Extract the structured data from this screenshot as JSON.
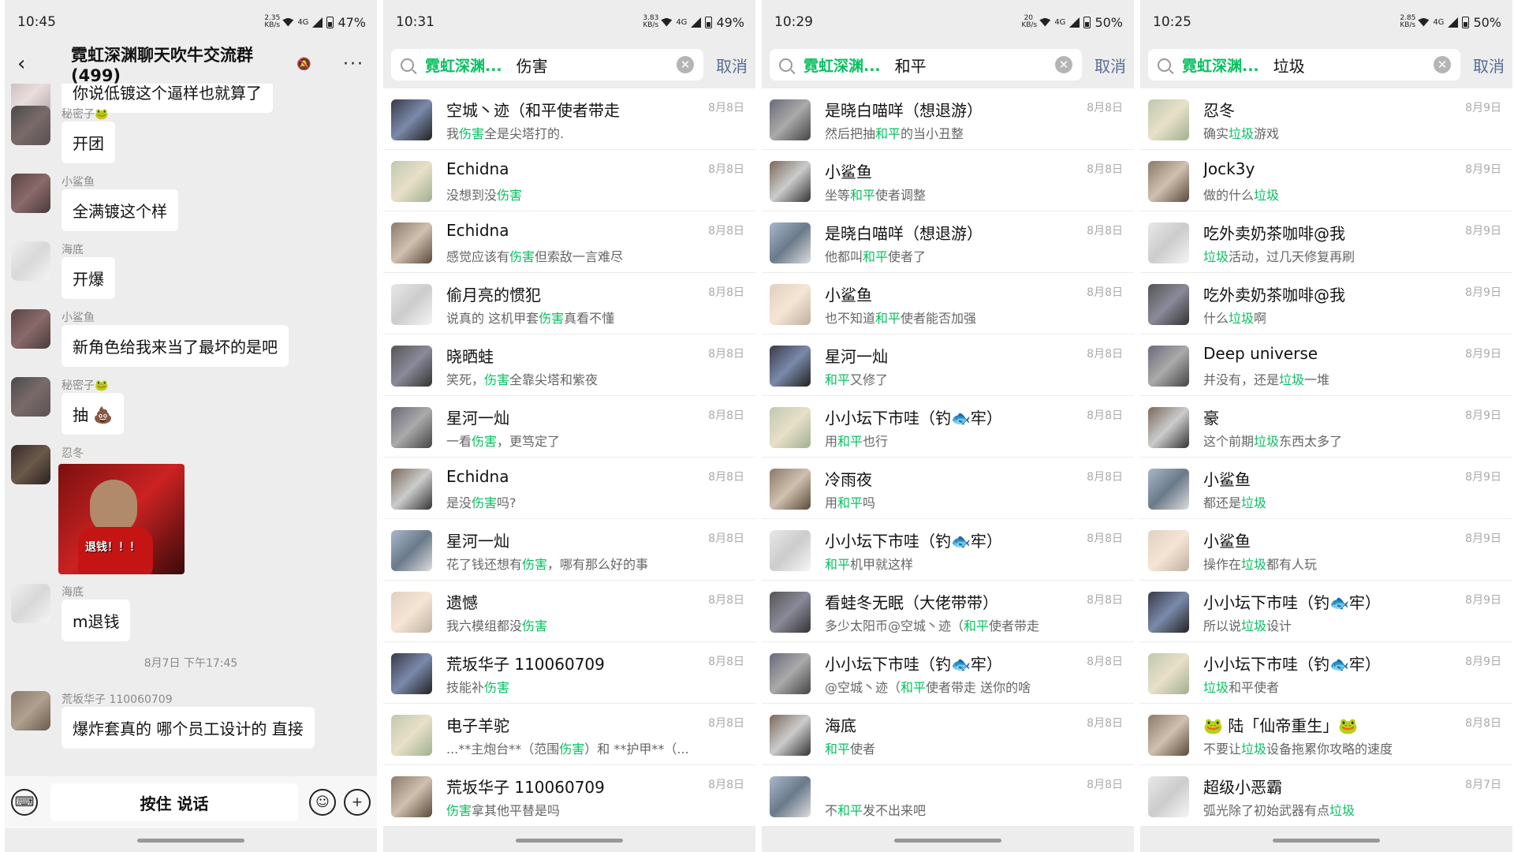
{
  "panels": [
    {
      "status": {
        "time": "10:45",
        "speed": "2.35 KB/s",
        "network": "4G",
        "battery": "47%"
      },
      "chat": {
        "title": "霓虹深渊聊天吹牛交流群(499)",
        "messages": [
          {
            "sender": "",
            "text": "你说低镀这个逼样也就算了"
          },
          {
            "sender": "秘密子🐸",
            "text": "开团"
          },
          {
            "sender": "小鲨鱼",
            "text": "全满镀这个样"
          },
          {
            "sender": "海底",
            "text": "开爆"
          },
          {
            "sender": "小鲨鱼",
            "text": "新角色给我来当了最坏的是吧"
          },
          {
            "sender": "秘密子🐸",
            "text": "抽 💩"
          },
          {
            "sender": "忍冬",
            "text": "",
            "image_caption": "退钱！！！"
          },
          {
            "sender": "海底",
            "text": "m退钱"
          },
          {
            "sender": "荒坂华子 110060709",
            "text": "爆炸套真的 哪个员工设计的 直接"
          }
        ],
        "date_divider": "8月7日 下午17:45",
        "input": {
          "hold_to_talk": "按住 说话"
        }
      }
    },
    {
      "status": {
        "time": "10:31",
        "speed": "3.83 KB/s",
        "network": "4G",
        "battery": "49%"
      },
      "search": {
        "chip": "霓虹深渊...",
        "keyword": "伤害",
        "cancel": "取消"
      },
      "results": [
        {
          "name": "空城丶迹（和平使者带走",
          "pre": "我",
          "hl": "伤害",
          "post": "全是尖塔打的.",
          "date": "8月8日"
        },
        {
          "name": "Echidna",
          "pre": "没想到没",
          "hl": "伤害",
          "post": "",
          "date": "8月8日"
        },
        {
          "name": "Echidna",
          "pre": "感觉应该有",
          "hl": "伤害",
          "post": "但索敌一言难尽",
          "date": "8月8日"
        },
        {
          "name": "偷月亮的惯犯",
          "pre": "说真的 这机甲套",
          "hl": "伤害",
          "post": "真看不懂",
          "date": "8月8日"
        },
        {
          "name": "晓晒蛙",
          "pre": "笑死，",
          "hl": "伤害",
          "post": "全靠尖塔和紫夜",
          "date": "8月8日"
        },
        {
          "name": "星河一灿",
          "pre": "一看",
          "hl": "伤害",
          "post": "，更笃定了",
          "date": "8月8日"
        },
        {
          "name": "Echidna",
          "pre": "是没",
          "hl": "伤害",
          "post": "吗?",
          "date": "8月8日"
        },
        {
          "name": "星河一灿",
          "pre": "花了钱还想有",
          "hl": "伤害",
          "post": "，哪有那么好的事",
          "date": "8月8日"
        },
        {
          "name": "遗憾",
          "pre": "我六模组都没",
          "hl": "伤害",
          "post": "",
          "date": "8月8日"
        },
        {
          "name": "荒坂华子 110060709",
          "pre": "技能补",
          "hl": "伤害",
          "post": "",
          "date": "8月8日"
        },
        {
          "name": "电子羊驼",
          "pre": "...**主炮台**（范围",
          "hl": "伤害",
          "post": "）和 **护甲**（...",
          "date": "8月8日"
        },
        {
          "name": "荒坂华子 110060709",
          "pre": "",
          "hl": "伤害",
          "post": "拿其他平替是吗",
          "date": "8月8日"
        }
      ]
    },
    {
      "status": {
        "time": "10:29",
        "speed": "20 KB/s",
        "network": "4G",
        "battery": "50%"
      },
      "search": {
        "chip": "霓虹深渊...",
        "keyword": "和平",
        "cancel": "取消"
      },
      "results": [
        {
          "name": "是晓白喵咩（想退游）",
          "pre": "然后把抽",
          "hl": "和平",
          "post": "的当小丑整",
          "date": "8月8日"
        },
        {
          "name": "小鲨鱼",
          "pre": "坐等",
          "hl": "和平",
          "post": "使者调整",
          "date": "8月8日"
        },
        {
          "name": "是晓白喵咩（想退游）",
          "pre": "他都叫",
          "hl": "和平",
          "post": "使者了",
          "date": "8月8日"
        },
        {
          "name": "小鲨鱼",
          "pre": "也不知道",
          "hl": "和平",
          "post": "使者能否加强",
          "date": "8月8日"
        },
        {
          "name": "星河一灿",
          "pre": "",
          "hl": "和平",
          "post": "又修了",
          "date": "8月8日"
        },
        {
          "name": "小小坛下市哇（钓🐟牢）",
          "pre": "用",
          "hl": "和平",
          "post": "也行",
          "date": "8月8日"
        },
        {
          "name": "冷雨夜",
          "pre": "用",
          "hl": "和平",
          "post": "吗",
          "date": "8月8日"
        },
        {
          "name": "小小坛下市哇（钓🐟牢）",
          "pre": "",
          "hl": "和平",
          "post": "机甲就这样",
          "date": "8月8日"
        },
        {
          "name": "看蛙冬无眠（大佬带带）",
          "pre": "多少太阳币@空城丶迹（",
          "hl": "和平",
          "post": "使者带走",
          "date": "8月8日"
        },
        {
          "name": "小小坛下市哇（钓🐟牢）",
          "pre": "@空城丶迹（",
          "hl": "和平",
          "post": "使者带走 送你的啥",
          "date": "8月8日"
        },
        {
          "name": "海底",
          "pre": "",
          "hl": "和平",
          "post": "使者",
          "date": "8月8日"
        },
        {
          "name": "",
          "pre": "不",
          "hl": "和平",
          "post": "发不出来吧",
          "date": "8月8日"
        }
      ]
    },
    {
      "status": {
        "time": "10:25",
        "speed": "2.85 KB/s",
        "network": "4G",
        "battery": "50%"
      },
      "search": {
        "chip": "霓虹深渊...",
        "keyword": "垃圾",
        "cancel": "取消"
      },
      "results": [
        {
          "name": "忍冬",
          "pre": "确实",
          "hl": "垃圾",
          "post": "游戏",
          "date": "8月9日"
        },
        {
          "name": "Jock3y",
          "pre": "做的什么",
          "hl": "垃圾",
          "post": "",
          "date": "8月9日"
        },
        {
          "name": "吃外卖奶茶咖啡@我",
          "pre": "",
          "hl": "垃圾",
          "post": "活动，过几天修复再刷",
          "date": "8月9日"
        },
        {
          "name": "吃外卖奶茶咖啡@我",
          "pre": "什么",
          "hl": "垃圾",
          "post": "啊",
          "date": "8月9日"
        },
        {
          "name": "Deep universe",
          "pre": "并没有，还是",
          "hl": "垃圾",
          "post": "一堆",
          "date": "8月9日"
        },
        {
          "name": "豪",
          "pre": "这个前期",
          "hl": "垃圾",
          "post": "东西太多了",
          "date": "8月9日"
        },
        {
          "name": "小鲨鱼",
          "pre": "都还是",
          "hl": "垃圾",
          "post": "",
          "date": "8月9日"
        },
        {
          "name": "小鲨鱼",
          "pre": "操作在",
          "hl": "垃圾",
          "post": "都有人玩",
          "date": "8月9日"
        },
        {
          "name": "小小坛下市哇（钓🐟牢）",
          "pre": "所以说",
          "hl": "垃圾",
          "post": "设计",
          "date": "8月9日"
        },
        {
          "name": "小小坛下市哇（钓🐟牢）",
          "pre": "",
          "hl": "垃圾",
          "post": "和平使者",
          "date": "8月9日"
        },
        {
          "name": "🐸 陆「仙帝重生」🐸",
          "pre": "不要让",
          "hl": "垃圾",
          "post": "设备拖累你攻略的速度",
          "date": "8月8日"
        },
        {
          "name": "超级小恶霸",
          "pre": "弧光除了初始武器有点",
          "hl": "垃圾",
          "post": "",
          "date": "8月7日"
        }
      ]
    }
  ],
  "colors": {
    "accent": "#07c160",
    "link": "#576b95",
    "bg": "#ededed"
  }
}
